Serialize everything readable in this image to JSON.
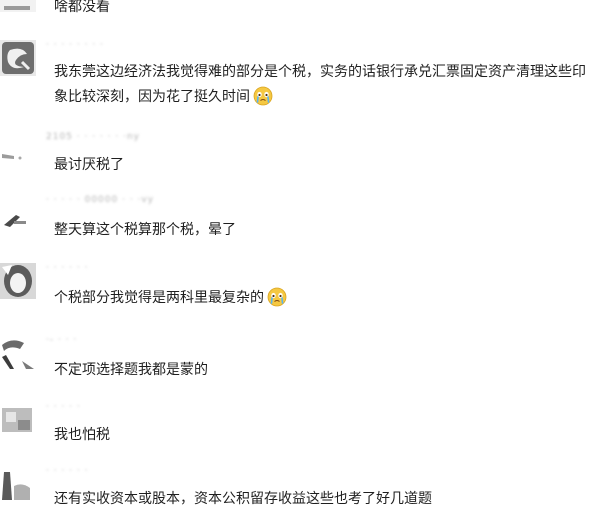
{
  "comments": [
    {
      "username": "",
      "text": "啥都没看",
      "emoji": false
    },
    {
      "username": "· · · · · · · ·",
      "text": "我东莞这边经济法我觉得难的部分是个税，实务的话银行承兑汇票固定资产清理这些印象比较深刻，因为花了挺久时间",
      "emoji": true,
      "emoji_name": "crying-face-icon"
    },
    {
      "username": "2105 · · · · ·  · ·ny",
      "text": "最讨厌税了",
      "emoji": false
    },
    {
      "username": "· · · · · 00000  · · ·vy",
      "text": "整天算这个税算那个税，晕了",
      "emoji": false
    },
    {
      "username": "· · · · · ·",
      "text": "个税部分我觉得是两科里最复杂的",
      "emoji": true,
      "emoji_name": "crying-face-icon"
    },
    {
      "username": "·- · · ·",
      "text": "不定项选择题我都是蒙的",
      "emoji": false
    },
    {
      "username": "· · · ·  ·",
      "text": "我也怕税",
      "emoji": false
    },
    {
      "username": "· · · · · ·",
      "text": "还有实收资本或股本，资本公积留存收益这些也考了好几道题",
      "emoji": false
    }
  ],
  "colors": {
    "text": "#1f1f1f",
    "username": "#b4b4b4",
    "emoji_face": "#f5c842"
  }
}
